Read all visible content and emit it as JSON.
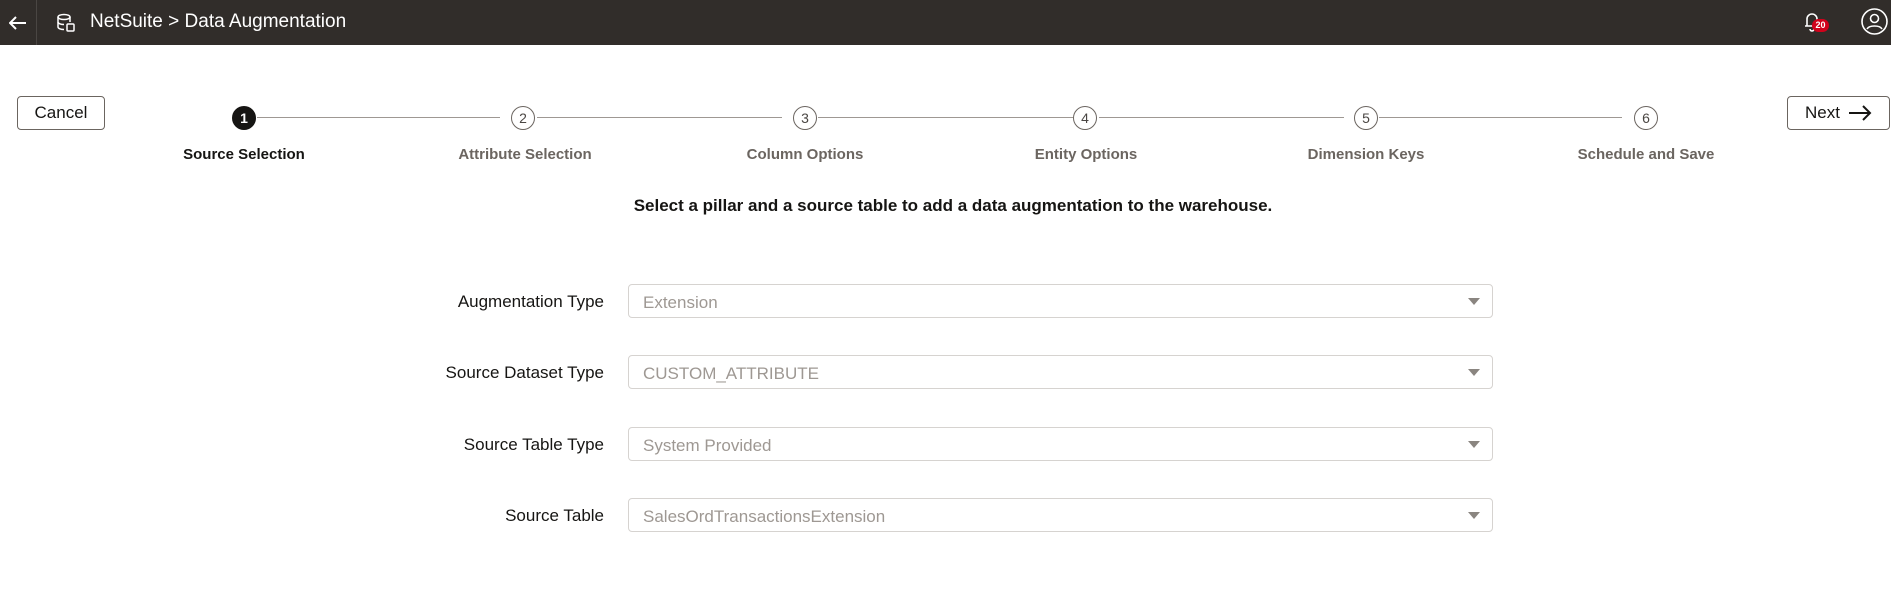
{
  "header": {
    "title": "NetSuite > Data Augmentation",
    "notification_count": "20",
    "icons": {
      "back": "arrow-left-icon",
      "app": "database-icon",
      "notifications": "bell-icon",
      "user": "user-avatar-icon"
    }
  },
  "actions": {
    "cancel_label": "Cancel",
    "next_label": "Next"
  },
  "stepper": {
    "steps": [
      {
        "number": "1",
        "label": "Source Selection",
        "active": true
      },
      {
        "number": "2",
        "label": "Attribute Selection",
        "active": false
      },
      {
        "number": "3",
        "label": "Column Options",
        "active": false
      },
      {
        "number": "4",
        "label": "Entity Options",
        "active": false
      },
      {
        "number": "5",
        "label": "Dimension Keys",
        "active": false
      },
      {
        "number": "6",
        "label": "Schedule and Save",
        "active": false
      }
    ]
  },
  "instruction": "Select a pillar and a source table to add a data augmentation to the warehouse.",
  "form": {
    "fields": [
      {
        "label": "Augmentation Type",
        "value": "Extension"
      },
      {
        "label": "Source Dataset Type",
        "value": "CUSTOM_ATTRIBUTE"
      },
      {
        "label": "Source Table Type",
        "value": "System Provided"
      },
      {
        "label": "Source Table",
        "value": "SalesOrdTransactionsExtension"
      }
    ]
  },
  "colors": {
    "header_bg": "#312d2a",
    "active_step": "#161513",
    "badge": "#d0021b"
  }
}
